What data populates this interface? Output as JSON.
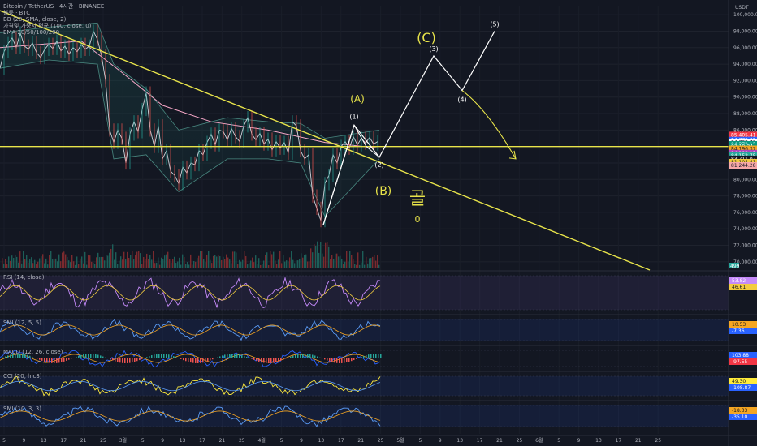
{
  "legend": {
    "line1": "Bitcoin / TetherUS · 4시간 · BINANCE",
    "line2": "볼륨 · BTC",
    "line3": "BB (20, SMA, close, 2)",
    "line4": "가격및 가중치 평균 (100, close, 0)",
    "line5": "EMA 20/50/100/200"
  },
  "currency": "USDT",
  "colors": {
    "bg": "#131722",
    "trend": "#e8e44a",
    "wave": "#ffffff",
    "price_line": "#e8e44a",
    "rsi": "#c58af9",
    "rsi_ma": "#f2cc40",
    "smi": "#5b9cf6",
    "macd": "#2962ff",
    "signal": "#f5a623",
    "cci": "#ffeb3b"
  },
  "price_axis": {
    "labels": [
      "100,000.00",
      "98,000.00",
      "96,000.00",
      "94,000.00",
      "92,000.00",
      "90,000.00",
      "88,000.00",
      "86,000.00",
      "84,000.00",
      "82,000.00",
      "80,000.00",
      "78,000.00",
      "76,000.00",
      "74,000.00",
      "72,000.00",
      "70,000.00"
    ],
    "tags": [
      {
        "text": "85,405.41",
        "color": "#f23645",
        "price": 85405
      },
      {
        "text": "84,779.08",
        "color": "#2962ff",
        "price": 84779
      },
      {
        "text": "84,702.73",
        "color": "#ffffff",
        "price": 84520
      },
      {
        "text": "84,372.12",
        "color": "#089981",
        "price": 84260
      },
      {
        "text": "03:19:34",
        "color": "#089981",
        "price": 84000
      },
      {
        "text": "84,196.37",
        "color": "#f5a623",
        "price": 83720
      },
      {
        "text": "84,193.12",
        "color": "#ab47bc",
        "price": 83200
      },
      {
        "text": "84,152.75",
        "color": "#26a69a",
        "price": 82900
      },
      {
        "text": "83,711.07",
        "color": "#131722",
        "price": 82500
      },
      {
        "text": "81,104.41",
        "color": "#f2cc40",
        "price": 82100
      },
      {
        "text": "81,244.28",
        "color": "#f7a8a8",
        "price": 81700
      }
    ]
  },
  "time_axis": [
    "5",
    "9",
    "13",
    "17",
    "21",
    "25",
    "3월",
    "5",
    "9",
    "13",
    "17",
    "21",
    "25",
    "4월",
    "5",
    "9",
    "13",
    "17",
    "21",
    "25",
    "5월",
    "5",
    "9",
    "13",
    "17",
    "21",
    "25",
    "6월",
    "5",
    "9",
    "13",
    "17",
    "21",
    "25"
  ],
  "annotations": {
    "A": "(A)",
    "B": "(B)",
    "C": "(C)",
    "w1": "(1)",
    "w2": "(2)",
    "w3": "(3)",
    "w4": "(4)",
    "w5": "(5)",
    "korean_note": "골",
    "korean_note2": "0"
  },
  "volume_tag": "499",
  "panes": {
    "rsi": {
      "label": "RSI (14, close)",
      "tags": [
        {
          "text": "53.82",
          "color": "#c58af9"
        },
        {
          "text": "46.61",
          "color": "#f2cc40"
        }
      ]
    },
    "smi1": {
      "label": "SMI (12, 5, 5)",
      "tags": [
        {
          "text": "10.53",
          "color": "#f5a623"
        },
        {
          "text": "-7.36",
          "color": "#2962ff"
        }
      ]
    },
    "macd": {
      "label": "MACD (12, 26, close)",
      "tags": [
        {
          "text": "103.88",
          "color": "#2962ff"
        },
        {
          "text": "-97.55",
          "color": "#f23645"
        }
      ]
    },
    "cci": {
      "label": "CCI (20, hlc3)",
      "tags": [
        {
          "text": "49.30",
          "color": "#ffeb3b"
        },
        {
          "text": "-108.87",
          "color": "#2962ff"
        }
      ]
    },
    "smi2": {
      "label": "SMI (10, 3, 3)",
      "tags": [
        {
          "text": "-18.33",
          "color": "#f5a623"
        },
        {
          "text": "-35.10",
          "color": "#2962ff"
        }
      ]
    }
  },
  "chart_data": {
    "type": "line",
    "title": "Bitcoin / TetherUS · 4시간 · BINANCE",
    "xlabel": "",
    "ylabel": "",
    "ylim": [
      69000,
      101000
    ],
    "price_series": [
      {
        "t": 0,
        "p": 93500
      },
      {
        "t": 5,
        "p": 95500
      },
      {
        "t": 10,
        "p": 96500
      },
      {
        "t": 15,
        "p": 97200
      },
      {
        "t": 20,
        "p": 96000
      },
      {
        "t": 25,
        "p": 97800
      },
      {
        "t": 30,
        "p": 96200
      },
      {
        "t": 35,
        "p": 95800
      },
      {
        "t": 40,
        "p": 96600
      },
      {
        "t": 45,
        "p": 95400
      },
      {
        "t": 50,
        "p": 94800
      },
      {
        "t": 55,
        "p": 95800
      },
      {
        "t": 60,
        "p": 96400
      },
      {
        "t": 65,
        "p": 95900
      },
      {
        "t": 70,
        "p": 96800
      },
      {
        "t": 75,
        "p": 95600
      },
      {
        "t": 80,
        "p": 96200
      },
      {
        "t": 85,
        "p": 95200
      },
      {
        "t": 90,
        "p": 96000
      },
      {
        "t": 95,
        "p": 95500
      },
      {
        "t": 100,
        "p": 96400
      },
      {
        "t": 105,
        "p": 95800
      },
      {
        "t": 110,
        "p": 96200
      },
      {
        "t": 115,
        "p": 98000
      },
      {
        "t": 120,
        "p": 97000
      },
      {
        "t": 125,
        "p": 95000
      },
      {
        "t": 130,
        "p": 92000
      },
      {
        "t": 135,
        "p": 86000
      },
      {
        "t": 140,
        "p": 84500
      },
      {
        "t": 145,
        "p": 86000
      },
      {
        "t": 150,
        "p": 85000
      },
      {
        "t": 155,
        "p": 82000
      },
      {
        "t": 160,
        "p": 85500
      },
      {
        "t": 165,
        "p": 87000
      },
      {
        "t": 170,
        "p": 85800
      },
      {
        "t": 175,
        "p": 88500
      },
      {
        "t": 180,
        "p": 90500
      },
      {
        "t": 185,
        "p": 86000
      },
      {
        "t": 190,
        "p": 84000
      },
      {
        "t": 195,
        "p": 86500
      },
      {
        "t": 200,
        "p": 82500
      },
      {
        "t": 205,
        "p": 83500
      },
      {
        "t": 210,
        "p": 81000
      },
      {
        "t": 215,
        "p": 80500
      },
      {
        "t": 220,
        "p": 79500
      },
      {
        "t": 225,
        "p": 81500
      },
      {
        "t": 230,
        "p": 80800
      },
      {
        "t": 235,
        "p": 82000
      },
      {
        "t": 240,
        "p": 81800
      },
      {
        "t": 245,
        "p": 83500
      },
      {
        "t": 250,
        "p": 83000
      },
      {
        "t": 255,
        "p": 84500
      },
      {
        "t": 260,
        "p": 85500
      },
      {
        "t": 265,
        "p": 84200
      },
      {
        "t": 270,
        "p": 86000
      },
      {
        "t": 275,
        "p": 85800
      },
      {
        "t": 280,
        "p": 84800
      },
      {
        "t": 285,
        "p": 86200
      },
      {
        "t": 290,
        "p": 85200
      },
      {
        "t": 295,
        "p": 84600
      },
      {
        "t": 300,
        "p": 86500
      },
      {
        "t": 305,
        "p": 87500
      },
      {
        "t": 310,
        "p": 85500
      },
      {
        "t": 315,
        "p": 84800
      },
      {
        "t": 320,
        "p": 85600
      },
      {
        "t": 325,
        "p": 84300
      },
      {
        "t": 330,
        "p": 84900
      },
      {
        "t": 335,
        "p": 83600
      },
      {
        "t": 340,
        "p": 84600
      },
      {
        "t": 345,
        "p": 83800
      },
      {
        "t": 350,
        "p": 84500
      },
      {
        "t": 355,
        "p": 83200
      },
      {
        "t": 360,
        "p": 87000
      },
      {
        "t": 365,
        "p": 86500
      },
      {
        "t": 370,
        "p": 83500
      },
      {
        "t": 375,
        "p": 82500
      },
      {
        "t": 380,
        "p": 83000
      },
      {
        "t": 385,
        "p": 78000
      },
      {
        "t": 390,
        "p": 76500
      },
      {
        "t": 395,
        "p": 75000
      },
      {
        "t": 400,
        "p": 79500
      },
      {
        "t": 405,
        "p": 80500
      },
      {
        "t": 410,
        "p": 83000
      },
      {
        "t": 415,
        "p": 82000
      },
      {
        "t": 420,
        "p": 84000
      },
      {
        "t": 425,
        "p": 84600
      },
      {
        "t": 430,
        "p": 83800
      },
      {
        "t": 435,
        "p": 85200
      },
      {
        "t": 440,
        "p": 84200
      },
      {
        "t": 445,
        "p": 85000
      },
      {
        "t": 450,
        "p": 84400
      },
      {
        "t": 455,
        "p": 85100
      },
      {
        "t": 460,
        "p": 84300
      },
      {
        "t": 465,
        "p": 84600
      }
    ],
    "horizontal_level": 84000,
    "trendline": {
      "p1": {
        "t": 0,
        "p": 100500
      },
      "p2": {
        "t": 800,
        "p": 69000
      }
    },
    "wave_path": [
      {
        "t": 398,
        "p": 74500
      },
      {
        "t": 436,
        "p": 86600
      },
      {
        "t": 467,
        "p": 82700
      },
      {
        "t": 534,
        "p": 95000
      },
      {
        "t": 569,
        "p": 90800
      },
      {
        "t": 609,
        "p": 98000
      }
    ],
    "projection": [
      {
        "t": 569,
        "p": 90800
      },
      {
        "t": 635,
        "p": 82500
      }
    ],
    "bb_upper": [
      {
        "t": 0,
        "p": 97800
      },
      {
        "t": 60,
        "p": 98500
      },
      {
        "t": 120,
        "p": 99000
      },
      {
        "t": 140,
        "p": 94000
      },
      {
        "t": 180,
        "p": 91000
      },
      {
        "t": 220,
        "p": 86000
      },
      {
        "t": 280,
        "p": 87500
      },
      {
        "t": 330,
        "p": 87000
      },
      {
        "t": 370,
        "p": 86800
      },
      {
        "t": 400,
        "p": 85000
      },
      {
        "t": 467,
        "p": 86000
      }
    ],
    "bb_lower": [
      {
        "t": 0,
        "p": 93500
      },
      {
        "t": 60,
        "p": 94500
      },
      {
        "t": 120,
        "p": 94000
      },
      {
        "t": 140,
        "p": 82500
      },
      {
        "t": 180,
        "p": 83000
      },
      {
        "t": 220,
        "p": 78500
      },
      {
        "t": 280,
        "p": 82500
      },
      {
        "t": 330,
        "p": 82500
      },
      {
        "t": 370,
        "p": 82000
      },
      {
        "t": 400,
        "p": 75500
      },
      {
        "t": 467,
        "p": 82500
      }
    ],
    "ema_slow": [
      {
        "t": 0,
        "p": 96000
      },
      {
        "t": 100,
        "p": 96800
      },
      {
        "t": 150,
        "p": 93000
      },
      {
        "t": 200,
        "p": 89000
      },
      {
        "t": 260,
        "p": 87000
      },
      {
        "t": 330,
        "p": 86000
      },
      {
        "t": 400,
        "p": 84500
      },
      {
        "t": 467,
        "p": 83800
      }
    ]
  }
}
